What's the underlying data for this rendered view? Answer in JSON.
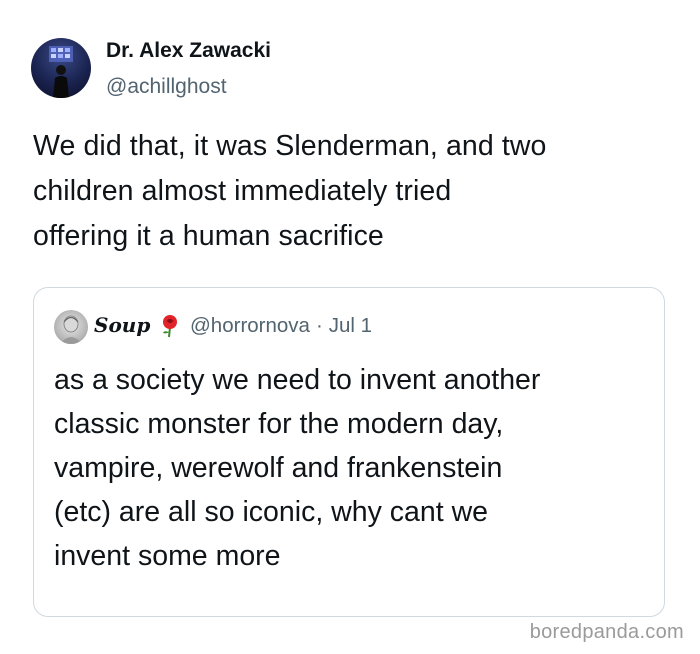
{
  "tweet": {
    "author_name": "Dr. Alex Zawacki",
    "author_handle": "@achillghost",
    "text_lines": [
      "We did that, it was Slenderman, and two",
      "children almost immediately tried",
      "offering it a human sacrifice"
    ]
  },
  "quoted_tweet": {
    "author_name": "Soup",
    "emoji_icon": "red-rose-icon",
    "author_handle": "@horrornova",
    "separator": "·",
    "date": "Jul 1",
    "text_lines": [
      "as a society we need to invent another",
      "classic monster for the modern day,",
      "vampire, werewolf and frankenstein",
      "(etc) are all so iconic, why cant we",
      "invent some more"
    ]
  },
  "watermark": "boredpanda.com",
  "colors": {
    "text": "#0f1419",
    "secondary_text": "#536471",
    "card_border": "#cfd9de",
    "watermark": "#9a9a9a"
  }
}
